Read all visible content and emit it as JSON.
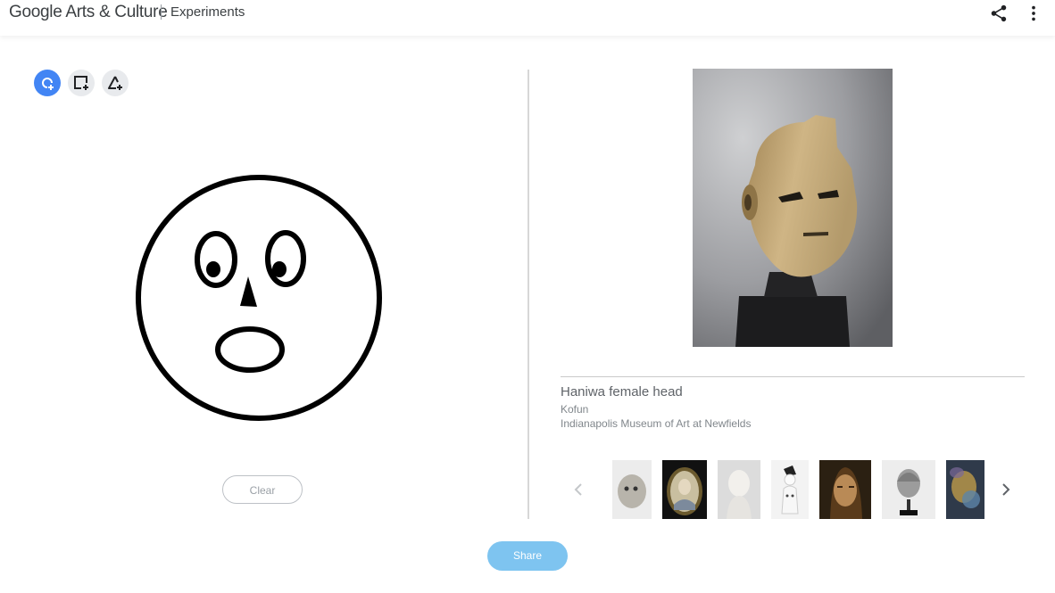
{
  "header": {
    "brand": "Google Arts & Culture",
    "section": "Experiments",
    "icons": [
      "share-icon",
      "more-vert-icon"
    ]
  },
  "tools": [
    {
      "icon": "lasso-add-icon",
      "active": true
    },
    {
      "icon": "crop-add-icon",
      "active": false
    },
    {
      "icon": "shape-add-icon",
      "active": false
    }
  ],
  "drawing": {
    "clear_label": "Clear"
  },
  "artwork": {
    "title": "Haniwa female head",
    "period": "Kofun",
    "museum": "Indianapolis Museum of Art at Newfields"
  },
  "carousel": {
    "prev_icon": "chevron-left-icon",
    "next_icon": "chevron-right-icon",
    "thumbnails": [
      "stone-face-thumbnail",
      "portrait-miniature-thumbnail",
      "white-bust-thumbnail",
      "figurine-thumbnail",
      "painted-portrait-thumbnail",
      "marble-head-thumbnail",
      "abstract-painting-thumbnail"
    ]
  },
  "footer": {
    "share_label": "Share"
  },
  "colors": {
    "accent": "#4285f4",
    "share_button": "#7ec4f0"
  }
}
